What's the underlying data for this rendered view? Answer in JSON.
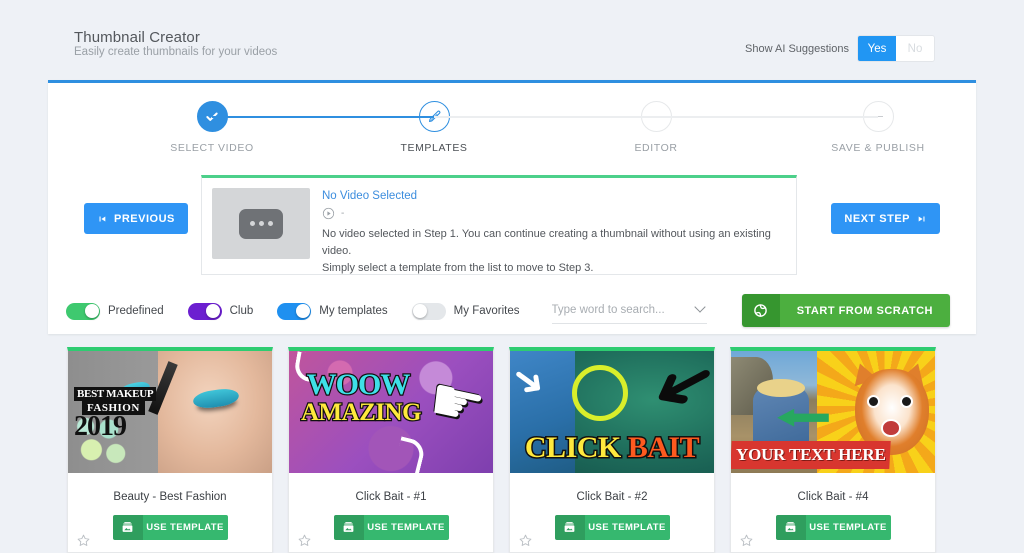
{
  "header": {
    "title": "Thumbnail Creator",
    "subtitle": "Easily create thumbnails for your videos",
    "ai_label": "Show AI Suggestions",
    "ai_yes": "Yes",
    "ai_no": "No",
    "ai_selected": "Yes"
  },
  "stepper": {
    "steps": [
      {
        "label": "SELECT VIDEO",
        "state": "done",
        "marker": "check"
      },
      {
        "label": "TEMPLATES",
        "state": "active",
        "marker": "pencil"
      },
      {
        "label": "EDITOR",
        "state": "todo",
        "marker": "dash"
      },
      {
        "label": "SAVE & PUBLISH",
        "state": "todo",
        "marker": "dash"
      }
    ]
  },
  "nav": {
    "previous": "PREVIOUS",
    "next": "NEXT STEP"
  },
  "video": {
    "title": "No Video Selected",
    "views": "-",
    "description_line1": "No video selected in Step 1. You can continue creating a thumbnail without using an existing video.",
    "description_line2": "Simply select a template from the list to move to Step 3."
  },
  "filters": {
    "toggles": [
      {
        "label": "Predefined",
        "on": true,
        "color": "#3ec96f"
      },
      {
        "label": "Club",
        "on": true,
        "color": "#6c1fd0"
      },
      {
        "label": "My templates",
        "on": true,
        "color": "#1f90f0"
      },
      {
        "label": "My Favorites",
        "on": false,
        "color": "#e4e7ea"
      }
    ],
    "search_placeholder": "Type word to search...",
    "search_value": "",
    "scratch_button": "START FROM SCRATCH"
  },
  "templates": {
    "use_label": "USE TEMPLATE",
    "cards": [
      {
        "name": "Beauty - Best Fashion",
        "art": "beauty",
        "overlay_line1": "BEST MAKEUP",
        "overlay_line2": "FASHION",
        "overlay_line3": "2019"
      },
      {
        "name": "Click Bait - #1",
        "art": "woow",
        "overlay_line1": "WOOW",
        "overlay_line2": "AMAZING"
      },
      {
        "name": "Click Bait - #2",
        "art": "clickbait",
        "overlay_line1": "CLICK",
        "overlay_line2": "BAIT"
      },
      {
        "name": "Click Bait - #4",
        "art": "cat",
        "overlay_line1": "YOUR TEXT HERE"
      }
    ]
  },
  "colors": {
    "page_bg": "#eef1f6",
    "panel_accent": "#2f8fe0",
    "card_accent": "#2ecc71",
    "primary_blue": "#2f95f5",
    "green": "#4caf3f"
  }
}
